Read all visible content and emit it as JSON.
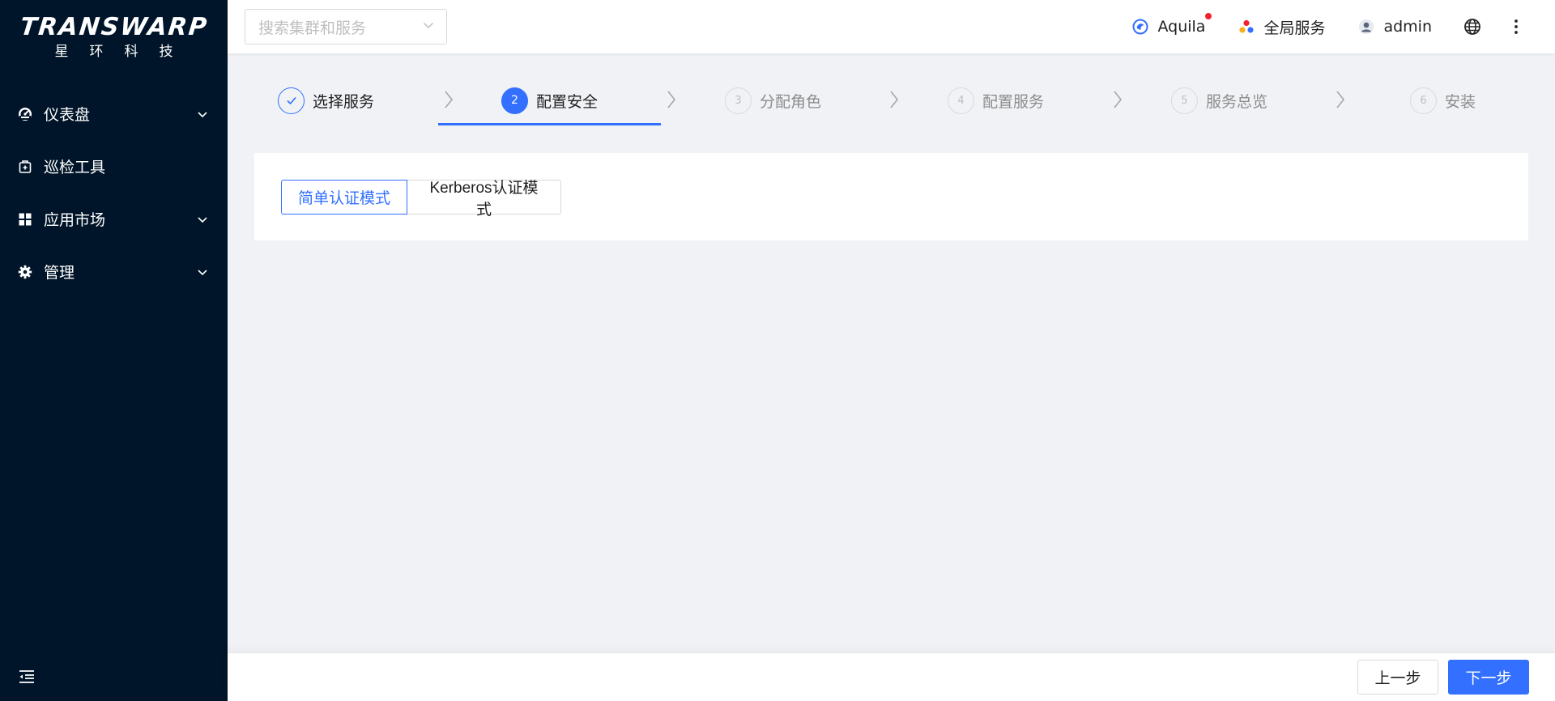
{
  "brand": {
    "name_en": "TRANSWARP",
    "name_cn": "星环科技"
  },
  "sidebar": {
    "items": [
      {
        "label": "仪表盘",
        "icon": "dashboard-icon",
        "has_arrow": true
      },
      {
        "label": "巡检工具",
        "icon": "inspection-icon",
        "has_arrow": false
      },
      {
        "label": "应用市场",
        "icon": "appstore-icon",
        "has_arrow": true
      },
      {
        "label": "管理",
        "icon": "gear-icon",
        "has_arrow": true
      }
    ],
    "collapse_icon": "menu-fold-icon"
  },
  "header": {
    "cluster_search_placeholder": "搜索集群和服务",
    "aquila_label": "Aquila",
    "global_services_label": "全局服务",
    "user_label": "admin",
    "language_icon": "globe-icon",
    "more_icon": "more-vertical-icon"
  },
  "steps": [
    {
      "number": "",
      "label": "选择服务",
      "status": "done"
    },
    {
      "number": "2",
      "label": "配置安全",
      "status": "active"
    },
    {
      "number": "3",
      "label": "分配角色",
      "status": "wait"
    },
    {
      "number": "4",
      "label": "配置服务",
      "status": "wait"
    },
    {
      "number": "5",
      "label": "服务总览",
      "status": "wait"
    },
    {
      "number": "6",
      "label": "安装",
      "status": "wait"
    }
  ],
  "auth_modes": {
    "simple": "简单认证模式",
    "kerberos": "Kerberos认证模式",
    "selected": "simple"
  },
  "footer": {
    "prev_label": "上一步",
    "next_label": "下一步"
  },
  "colors": {
    "primary": "#3370ff",
    "sidebar_bg": "#001529",
    "notification": "#f5222d"
  }
}
